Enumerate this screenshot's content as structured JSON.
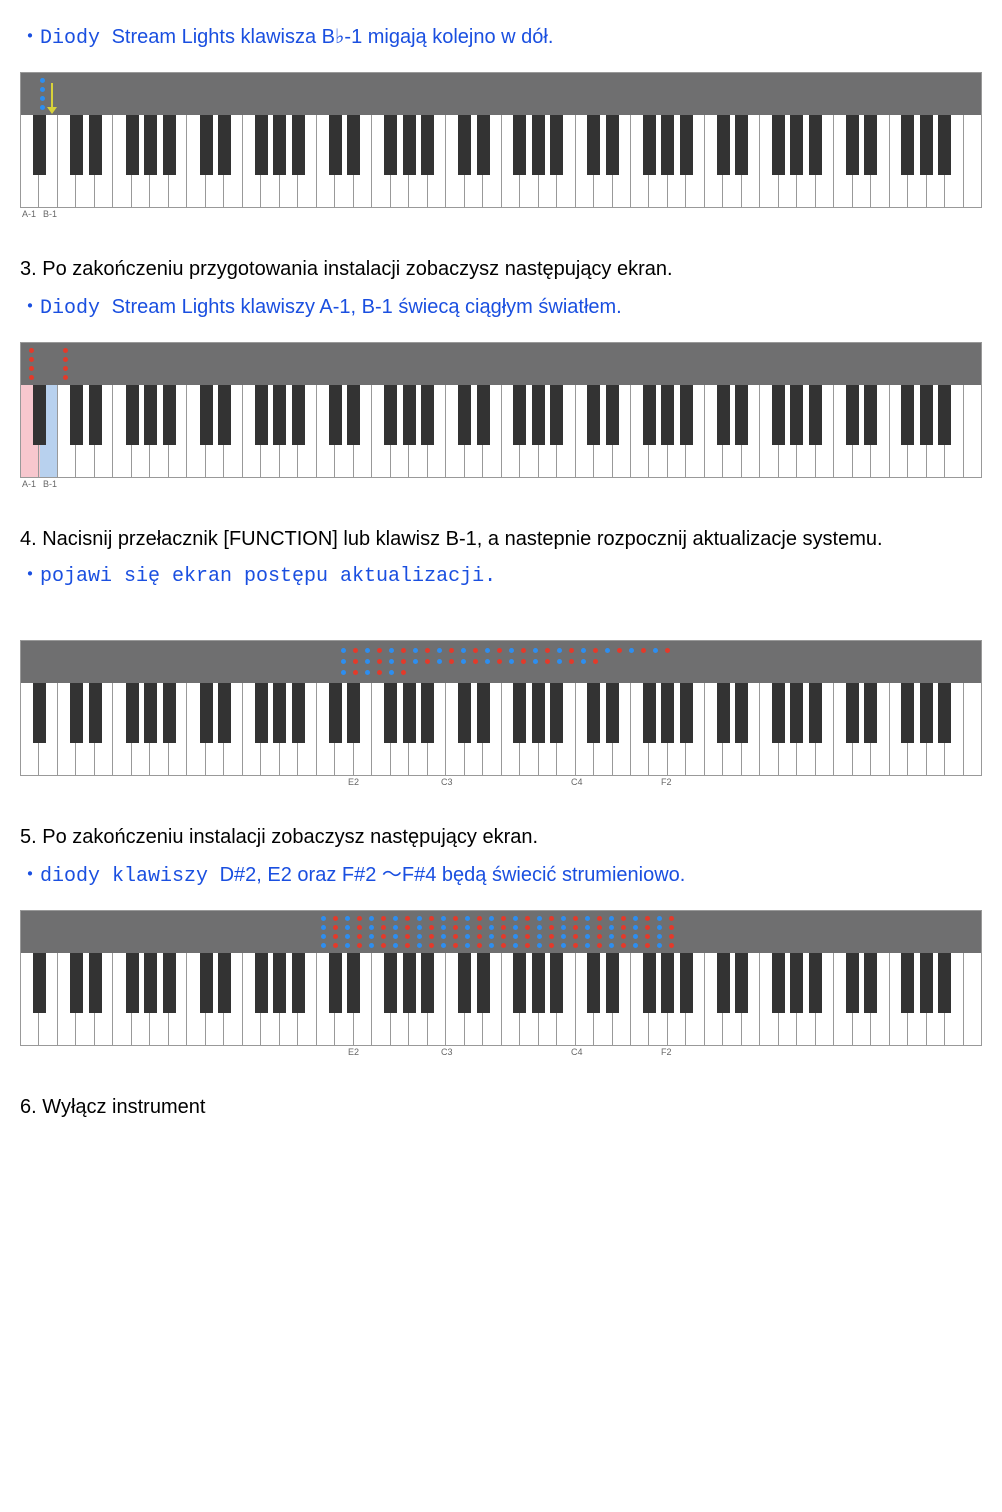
{
  "bullet1_keyword": "・Diody",
  "bullet1_rest": " Stream Lights klawisza B♭-1 migają kolejno w dół.",
  "step3": "3. Po zakończeniu przygotowania instalacji zobaczysz następujący ekran.",
  "bullet3_keyword": "・Diody",
  "bullet3_rest": " Stream Lights klawiszy A-1, B-1 świecą ciągłym światłem.",
  "step4": "4. Nacisnij przełacznik [FUNCTION] lub klawisz B-1, a nastepnie rozpocznij aktualizacje systemu.",
  "bullet4_full": "・pojawi się ekran postępu aktualizacji.",
  "step5": "5. Po zakończeniu instalacji zobaczysz następujący ekran.",
  "bullet5_keyword": "・diody klawiszy",
  "bullet5_rest": " D#2, E2 oraz F#2 ～F#4 będą świecić strumieniowo.",
  "step6": "6. Wyłącz instrument",
  "label_a1": "A-1",
  "label_b1": "B-1",
  "label_e2": "E2",
  "label_c3": "C3",
  "label_c4": "C4",
  "label_f2": "F2",
  "kb1_labels": [
    "A-1",
    "B-1"
  ],
  "kb2_labels": [
    "A-1",
    "B-1"
  ],
  "kb3_labels": [
    "E2",
    "C3",
    "C4",
    "F2"
  ],
  "kb4_labels": [
    "E2",
    "C3",
    "C4",
    "F2"
  ]
}
